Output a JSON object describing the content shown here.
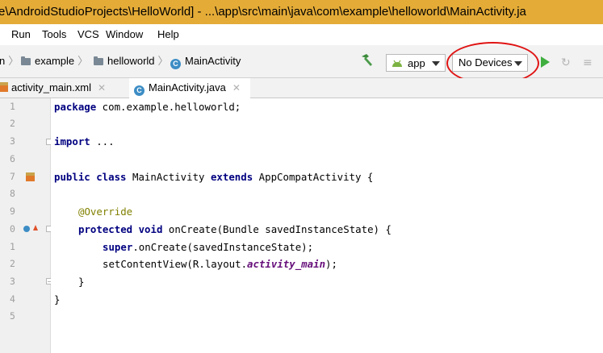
{
  "window": {
    "title": "e\\AndroidStudioProjects\\HelloWorld] - ...\\app\\src\\main\\java\\com\\example\\helloworld\\MainActivity.ja"
  },
  "menu": {
    "items": [
      {
        "label": "Run"
      },
      {
        "label": "Tools"
      },
      {
        "label": "VCS"
      },
      {
        "label": "Window"
      },
      {
        "label": "Help"
      }
    ]
  },
  "breadcrumb": {
    "lead": "n",
    "items": [
      {
        "label": "example",
        "icon": "folder-icon"
      },
      {
        "label": "helloworld",
        "icon": "folder-icon"
      },
      {
        "label": "MainActivity",
        "icon": "class-icon"
      }
    ]
  },
  "toolbar": {
    "run_config": "app",
    "device": "No Devices",
    "icons": [
      "hammer-icon",
      "android-icon",
      "run-icon",
      "apply-changes-icon",
      "more-icon"
    ],
    "highlight_color": "#e01414",
    "run_color": "#3fae3f"
  },
  "tabs": [
    {
      "label": "activity_main.xml",
      "icon": "xml-file-icon",
      "active": false
    },
    {
      "label": "MainActivity.java",
      "icon": "java-class-icon",
      "active": true
    }
  ],
  "gutter": {
    "line_numbers": [
      "1",
      "2",
      "3",
      "6",
      "7",
      "8",
      "9",
      "0",
      "1",
      "2",
      "3",
      "4",
      "5"
    ]
  },
  "code": {
    "line1_kw": "package",
    "line1_rest": " com.example.helloworld;",
    "line3_kw": "import",
    "line3_rest": " ...",
    "line7_kw1": "public class",
    "line7_mid": " MainActivity ",
    "line7_kw2": "extends",
    "line7_rest": " AppCompatActivity {",
    "line9_ann": "@Override",
    "line10_kw": "protected void",
    "line10_rest": " onCreate(Bundle savedInstanceState) {",
    "line11_kw": "super",
    "line11_rest": ".onCreate(savedInstanceState);",
    "line12_pre": "setContentView(R.layout.",
    "line12_field": "activity_main",
    "line12_post": ");",
    "line13": "}",
    "line14": "}"
  },
  "colors": {
    "title_bar": "#e4ab37",
    "keyword": "#000080",
    "annotation": "#808000",
    "field": "#660e7a",
    "current_line": "#fdf8d8"
  }
}
